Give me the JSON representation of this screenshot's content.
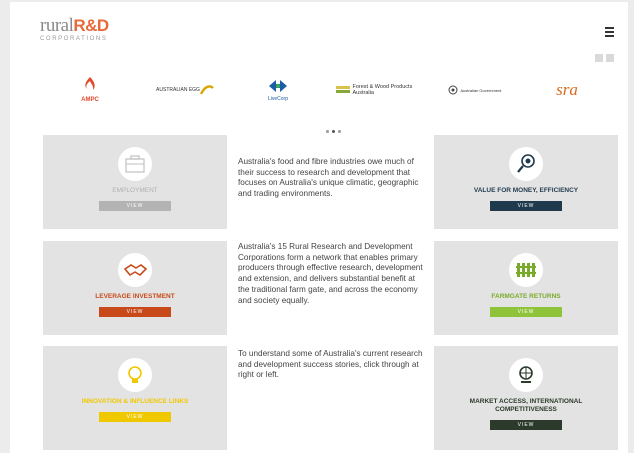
{
  "header": {
    "logo_main": "rural",
    "logo_rd": "R&D",
    "logo_sub": "CORPORATIONS"
  },
  "partners": [
    {
      "name": "AMPC",
      "color": "#e34a2a",
      "icon": "amp-flame-icon"
    },
    {
      "name": "AUSTRALIAN EGG",
      "color": "#d9a400",
      "icon": "egg-swoosh-icon"
    },
    {
      "name": "LiveCorp",
      "color": "#1a5ca8",
      "icon": "livecorp-arrows-icon"
    },
    {
      "name": "Forest & Wood Products Australia",
      "color": "#6a8a2a",
      "icon": "fwpa-leaf-icon"
    },
    {
      "name": "Australian Government",
      "color": "#444444",
      "icon": "crest-icon"
    },
    {
      "name": "sra",
      "color": "#d86a20",
      "icon": "sra-icon"
    }
  ],
  "cards": {
    "employment": {
      "title": "EMPLOYMENT",
      "btn": "VIEW",
      "title_color": "#b0b0b0",
      "btn_color": "#b3b3b3"
    },
    "value": {
      "title": "VALUE FOR MONEY, EFFICIENCY",
      "btn": "VIEW",
      "title_color": "#1f3a4d",
      "btn_color": "#1f3a4d"
    },
    "leverage": {
      "title": "LEVERAGE INVESTMENT",
      "btn": "VIEW",
      "title_color": "#c84a1a",
      "btn_color": "#c84a1a"
    },
    "farmgate": {
      "title": "FARMGATE RETURNS",
      "btn": "VIEW",
      "title_color": "#7aaa2a",
      "btn_color": "#8fc33a"
    },
    "innovation": {
      "title": "INNOVATION & INFLUENCE LINKS",
      "btn": "VIEW",
      "title_color": "#f0c800",
      "btn_color": "#f0c800"
    },
    "market": {
      "title": "MARKET ACCESS, INTERNATIONAL COMPETITIVENESS",
      "btn": "VIEW",
      "title_color": "#2b3a2a",
      "btn_color": "#2b3a2a"
    }
  },
  "text": {
    "p1": "Australia's food and fibre industries owe much of their success to research and development that focuses on Australia's unique climatic, geographic and trading environments.",
    "p2": "Australia's 15 Rural Research and Development Corporations form a network that enables primary producers through effective research, development and extension, and delivers substantial benefit at the traditional farm gate, and across the economy and society equally.",
    "p3": "To understand some of Australia's current research and development success stories, click through at right or left."
  }
}
